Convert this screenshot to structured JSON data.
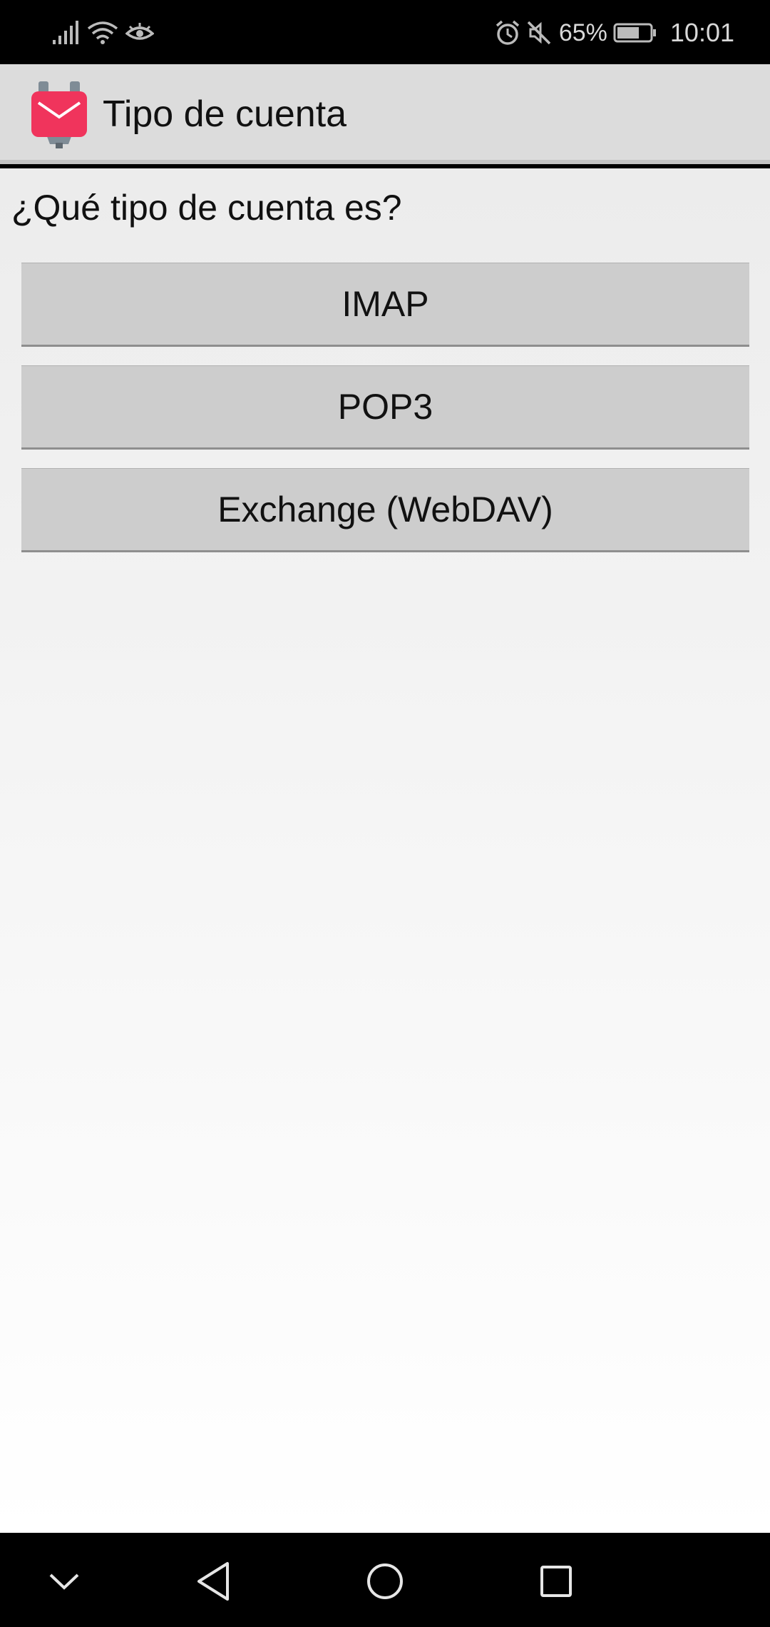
{
  "status_bar": {
    "icons_left": [
      "signal-icon",
      "wifi-icon",
      "eye-icon"
    ],
    "icons_right": [
      "alarm-icon",
      "mute-icon",
      "battery-icon"
    ],
    "battery_percent": "65%",
    "time": "10:01"
  },
  "action_bar": {
    "icon": "k9-mail-app-icon",
    "title": "Tipo de cuenta"
  },
  "main": {
    "question": "¿Qué tipo de cuenta es?",
    "buttons": [
      {
        "label": "IMAP"
      },
      {
        "label": "POP3"
      },
      {
        "label": "Exchange (WebDAV)"
      }
    ]
  },
  "nav_bar": {
    "icons": [
      "hide-keyboard-icon",
      "back-icon",
      "home-icon",
      "recent-apps-icon"
    ]
  },
  "colors": {
    "app_icon_red": "#f0345c",
    "app_icon_gray": "#7f8c96",
    "button_bg": "#cdcdcd",
    "action_bar_bg": "#dcdcdc"
  }
}
